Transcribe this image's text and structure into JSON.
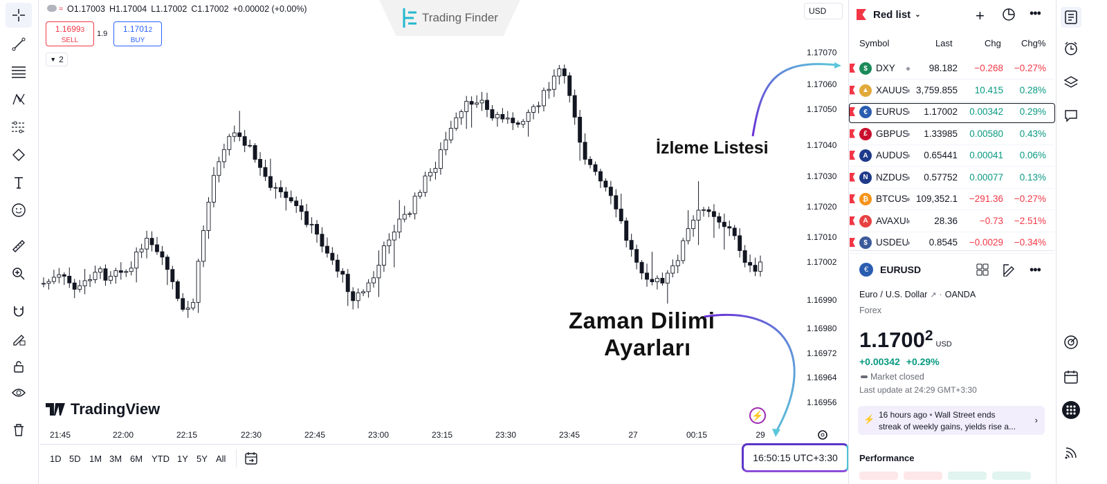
{
  "ohlc": {
    "o": "O1.17003",
    "h": "H1.17004",
    "l": "L1.17002",
    "c": "C1.17002",
    "chg": "+0.00002 (+0.00%)"
  },
  "trade": {
    "sell_price": "1.1699",
    "sell_sup": "3",
    "sell_label": "SELL",
    "spread": "1.9",
    "buy_price": "1.1701",
    "buy_sup": "2",
    "buy_label": "BUY",
    "collapse_count": "2"
  },
  "logo_text": "Trading Finder",
  "currency": "USD",
  "price_ticks": [
    "1.17070",
    "1.17060",
    "1.17050",
    "1.17040",
    "1.17030",
    "1.17020",
    "1.17010",
    "1.16990",
    "1.16980",
    "1.16972",
    "1.16964",
    "1.16956"
  ],
  "current_price": "1.17002",
  "time_ticks": [
    "21:45",
    "22:00",
    "22:15",
    "22:30",
    "22:45",
    "23:00",
    "23:15",
    "23:30",
    "23:45",
    "27",
    "00:15",
    "29"
  ],
  "tv_brand": "TradingView",
  "periods": [
    "1D",
    "5D",
    "1M",
    "3M",
    "6M",
    "YTD",
    "1Y",
    "5Y",
    "All"
  ],
  "clock": "16:50:15 UTC+3:30",
  "annotations": {
    "watchlist": "İzleme Listesi",
    "timezone_line1": "Zaman Dilimi",
    "timezone_line2": "Ayarları"
  },
  "watchlist": {
    "title": "Red list",
    "headers": {
      "symbol": "Symbol",
      "last": "Last",
      "chg": "Chg",
      "pct": "Chg%"
    },
    "rows": [
      {
        "symbol": "DXY",
        "last": "98.182",
        "chg": "−0.268",
        "pct": "−0.27%",
        "dir": "neg",
        "icon": "dollar-icon",
        "icon_color": "#1b8a5a",
        "glyph": "$"
      },
      {
        "symbol": "XAUUSD",
        "last": "3,759.855",
        "chg": "10.415",
        "pct": "0.28%",
        "dir": "pos",
        "icon": "gold-icon",
        "icon_color": "#e2a93b",
        "glyph": "▲"
      },
      {
        "symbol": "EURUSD",
        "last": "1.17002",
        "chg": "0.00342",
        "pct": "0.29%",
        "dir": "pos",
        "icon": "eu-flag-icon",
        "icon_color": "#2a5db0",
        "glyph": "€"
      },
      {
        "symbol": "GBPUSD",
        "last": "1.33985",
        "chg": "0.00580",
        "pct": "0.43%",
        "dir": "pos",
        "icon": "gb-flag-icon",
        "icon_color": "#c8102e",
        "glyph": "£"
      },
      {
        "symbol": "AUDUSD",
        "last": "0.65441",
        "chg": "0.00041",
        "pct": "0.06%",
        "dir": "pos",
        "icon": "au-flag-icon",
        "icon_color": "#1e3a8a",
        "glyph": "A"
      },
      {
        "symbol": "NZDUSD",
        "last": "0.57752",
        "chg": "0.00077",
        "pct": "0.13%",
        "dir": "pos",
        "icon": "nz-flag-icon",
        "icon_color": "#1e3a8a",
        "glyph": "N"
      },
      {
        "symbol": "BTCUSD",
        "last": "109,352.1",
        "chg": "−291.36",
        "pct": "−0.27%",
        "dir": "neg",
        "icon": "bitcoin-icon",
        "icon_color": "#f7931a",
        "glyph": "₿"
      },
      {
        "symbol": "AVAXUSD",
        "last": "28.36",
        "chg": "−0.73",
        "pct": "−2.51%",
        "dir": "neg",
        "icon": "avax-icon",
        "icon_color": "#e84142",
        "glyph": "A"
      },
      {
        "symbol": "USDEUR",
        "last": "0.8545",
        "chg": "−0.0029",
        "pct": "−0.34%",
        "dir": "neg",
        "icon": "us-flag-icon",
        "icon_color": "#3c5a9a",
        "glyph": "$"
      }
    ]
  },
  "detail": {
    "symbol": "EURUSD",
    "name": "Euro",
    "sep": "/",
    "name2": "U.S. Dollar",
    "broker": "OANDA",
    "category": "Forex",
    "price": "1.1700",
    "price_sup": "2",
    "currency": "USD",
    "chg": "+0.00342",
    "pct": "+0.29%",
    "status": "Market closed",
    "update": "Last update at 24:29 GMT+3:30",
    "news_time": "16 hours ago",
    "news_text_1": "Wall Street ends",
    "news_text_2": "streak of weekly gains, yields rise a...",
    "performance": "Performance"
  }
}
